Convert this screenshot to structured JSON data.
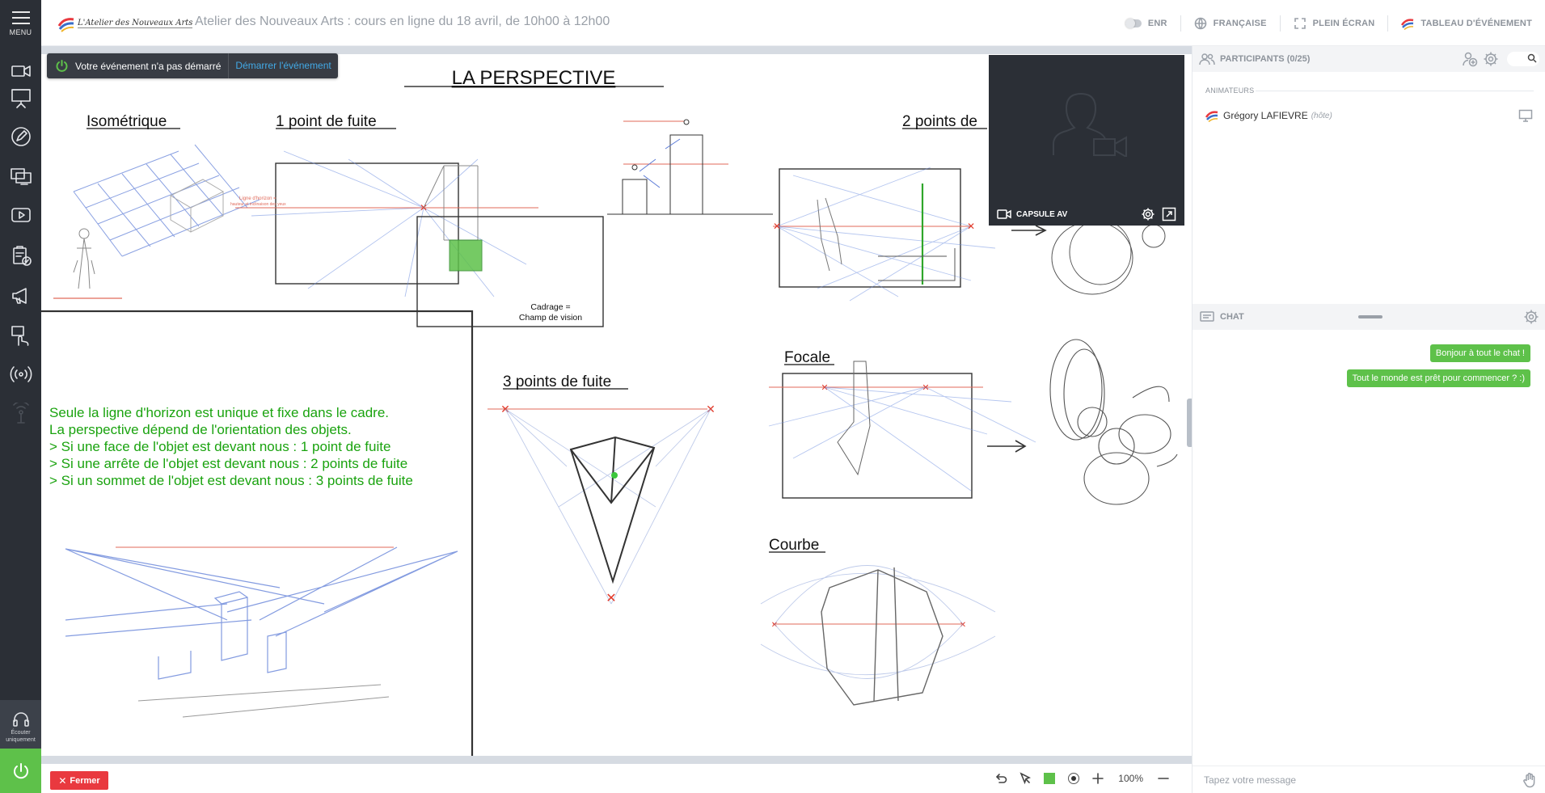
{
  "sidebar": {
    "menu_label": "MENU",
    "listen_label": "Écouter uniquement",
    "items": [
      {
        "icon": "camera-icon"
      },
      {
        "icon": "presentation-icon"
      },
      {
        "icon": "pencil-icon"
      },
      {
        "icon": "screen-share-icon"
      },
      {
        "icon": "video-play-icon"
      },
      {
        "icon": "clipboard-check-icon"
      },
      {
        "icon": "megaphone-icon"
      },
      {
        "icon": "hand-touch-icon"
      },
      {
        "icon": "broadcast-icon"
      },
      {
        "icon": "antenna-icon"
      }
    ]
  },
  "topbar": {
    "logo_text": "L'Atelier des Nouveaux Arts",
    "title": "Atelier des Nouveaux Arts : cours en ligne du 18 avril, de 10h00 à 12h00",
    "record_label": "ENR",
    "language_label": "FRANÇAISE",
    "fullscreen_label": "PLEIN ÉCRAN",
    "dashboard_label": "TABLEAU D'ÉVÉNEMENT"
  },
  "notice": {
    "message": "Votre événement n'a pas démarré",
    "start_label": "Démarrer l'événement"
  },
  "video": {
    "name": "CAPSULE AV"
  },
  "slide": {
    "title": "LA PERSPECTIVE",
    "headings": {
      "isometric": "Isométrique",
      "one_point": "1 point de fuite",
      "two_points": "2 points de",
      "three_points": "3 points de fuite",
      "focal": "Focale",
      "curve": "Courbe"
    },
    "frame_caption_1": "Cadrage =",
    "frame_caption_2": "Champ de vision",
    "horizon_note_1": "Ligne d'horizon =",
    "horizon_note_2": "hauteur et inclinaison des yeux",
    "text_lines": [
      "Seule la ligne d'horizon est unique et fixe dans le cadre.",
      "La perspective dépend de l'orientation des objets.",
      "> Si une face de l'objet est devant nous : 1 point de fuite",
      "> Si une arrête de l'objet est devant nous : 2 points de fuite",
      "> Si un sommet de l'objet est devant nous : 3 points de fuite"
    ]
  },
  "bottombar": {
    "close_label": "Fermer",
    "zoom": "100%",
    "color": "#5ec14a"
  },
  "participants": {
    "header": "PARTICIPANTS (0/25)",
    "section": "ANIMATEURS",
    "host_name": "Grégory LAFIEVRE",
    "host_role": "(hôte)"
  },
  "chat": {
    "header": "CHAT",
    "messages": [
      "Bonjour à tout le chat !",
      "Tout le monde est prêt pour commencer ? :)"
    ],
    "placeholder": "Tapez votre message"
  },
  "colors": {
    "sidebar": "#2b2f36",
    "accent_green": "#5ec14a",
    "danger_red": "#e9393f",
    "link_blue": "#42a9e6"
  }
}
